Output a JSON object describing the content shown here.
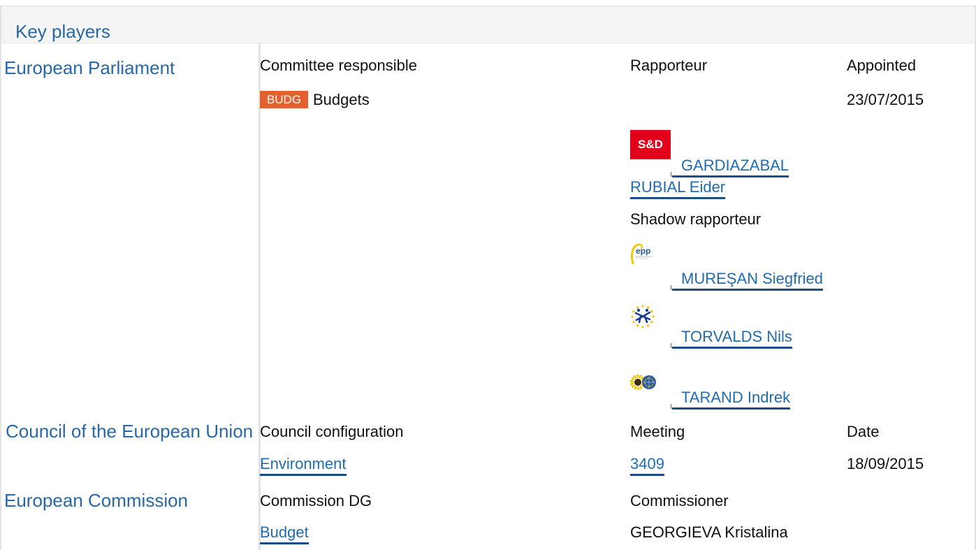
{
  "header": {
    "title": "Key players"
  },
  "colors": {
    "institution": "#2868a6",
    "link": "#1f6cb1",
    "link_underline": "#1d4c85",
    "committee_badge": "#e2612e",
    "header_background": "#f5f5f5"
  },
  "european_parliament": {
    "name": "European Parliament",
    "labels": {
      "committee_responsible": "Committee responsible",
      "rapporteur": "Rapporteur",
      "appointed": "Appointed",
      "shadow_rapporteur": "Shadow rapporteur"
    },
    "committee": {
      "code": "BUDG",
      "name": "Budgets"
    },
    "appointed": "23/07/2015",
    "rapporteur": {
      "name": "GARDIAZABAL RUBIAL Eider",
      "group_icon": "sd-group-logo",
      "logo_text": "S&D"
    },
    "shadow_rapporteurs": [
      {
        "name": "MUREŞAN Siegfried",
        "group_icon": "epp-group-logo",
        "logo_text": "epp"
      },
      {
        "name": "TORVALDS Nils",
        "group_icon": "alde-group-logo"
      },
      {
        "name": "TARAND Indrek",
        "group_icon": "greens-efa-group-logo"
      }
    ]
  },
  "council": {
    "name": "Council of the European Union",
    "labels": {
      "configuration": "Council configuration",
      "meeting": "Meeting",
      "date": "Date"
    },
    "configuration": "Environment",
    "meeting": "3409",
    "date": "18/09/2015"
  },
  "commission": {
    "name": "European Commission",
    "labels": {
      "dg": "Commission DG",
      "commissioner": "Commissioner"
    },
    "dg": "Budget",
    "commissioner": "GEORGIEVA Kristalina"
  }
}
